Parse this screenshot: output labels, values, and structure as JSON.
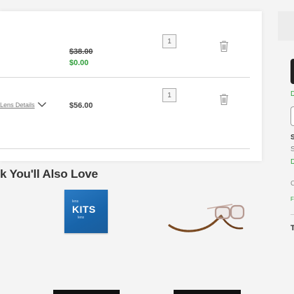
{
  "cart": {
    "items": [
      {
        "original_price": "$38.00",
        "sale_price": "$0.00",
        "quantity": "1"
      },
      {
        "lens_details_link": "Lens Details",
        "price": "$56.00",
        "quantity": "1"
      }
    ]
  },
  "recommendations": {
    "title": "k You'll Also Love",
    "products": [
      {
        "packaging_small_top": "lens",
        "packaging_main": "KITS",
        "packaging_small_bottom": "lens"
      },
      {
        "image": "glasses-with-tortoise-chain"
      }
    ]
  },
  "sidebar": {
    "letters": [
      "D",
      "S",
      "S",
      "D",
      "C",
      "F",
      "T"
    ]
  },
  "colors": {
    "sale_green": "#2f9e3a",
    "brand_blue": "#1864aa",
    "cta_black": "#111111"
  },
  "icons": [
    "trash-icon",
    "chevron-down-icon"
  ]
}
